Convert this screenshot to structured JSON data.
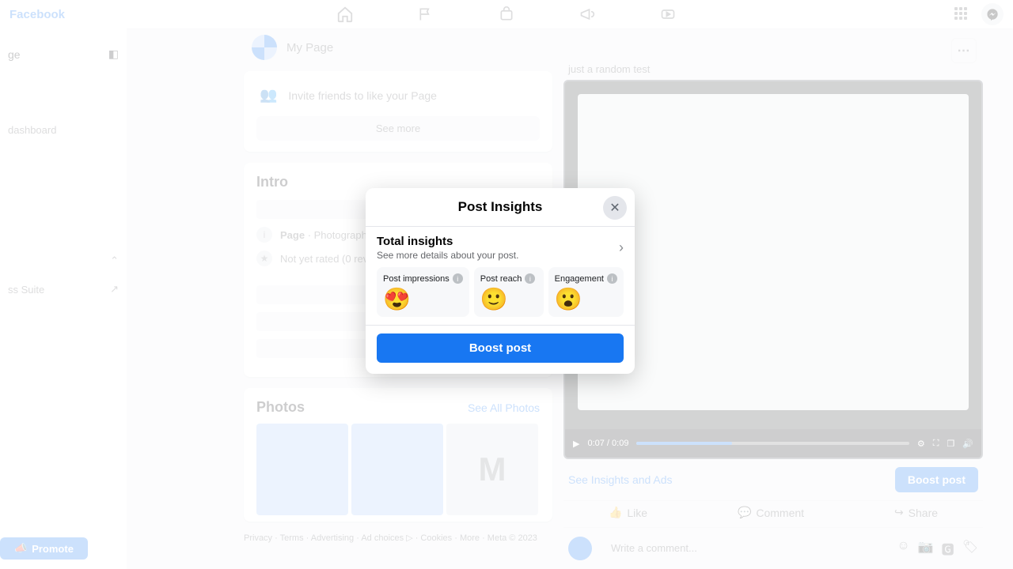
{
  "topnav": {
    "brand": "Facebook"
  },
  "sidebar": {
    "page_label": "ge",
    "dashboard": "dashboard",
    "suite": "ss Suite",
    "promote": "Promote"
  },
  "page": {
    "name": "My Page"
  },
  "invite": {
    "label": "Invite friends to like your Page",
    "seemore": "See more"
  },
  "intro": {
    "title": "Intro",
    "category_prefix": "Page",
    "category": "Photography an",
    "rating": "Not yet rated (0 review"
  },
  "photos": {
    "title": "Photos",
    "see_all": "See All Photos",
    "m_label": "M"
  },
  "footer": "Privacy · Terms · Advertising · Ad choices ▷ · Cookies · More · Meta © 2023",
  "post": {
    "desc": "just a random test",
    "time": "0:07 / 0:09",
    "insights_link": "See Insights and Ads",
    "boost": "Boost post",
    "like": "Like",
    "comment": "Comment",
    "share": "Share",
    "comment_placeholder": "Write a comment..."
  },
  "modal": {
    "title": "Post Insights",
    "total": "Total insights",
    "total_sub": "See more details about your post.",
    "stats": [
      {
        "label": "Post impressions",
        "emoji": "😍"
      },
      {
        "label": "Post reach",
        "emoji": "🙂"
      },
      {
        "label": "Engagement",
        "emoji": "😮"
      }
    ],
    "boost": "Boost post"
  }
}
